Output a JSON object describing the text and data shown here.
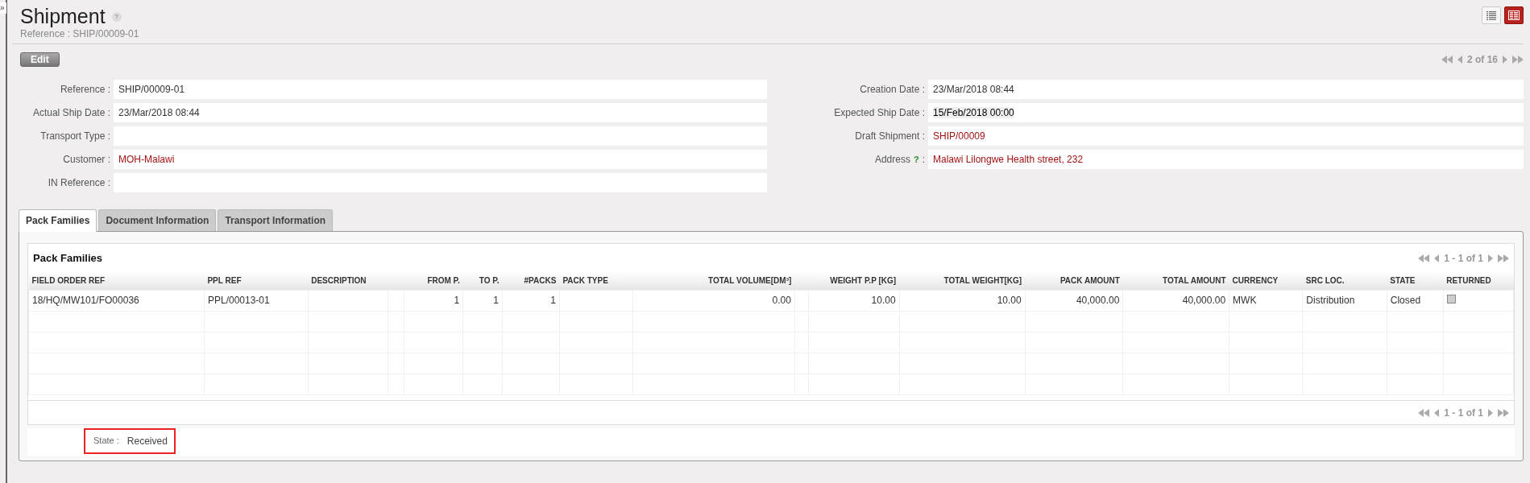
{
  "sidebar_toggle": "»",
  "header": {
    "title": "Shipment",
    "help": "?",
    "subtitle": "Reference : SHIP/00009-01"
  },
  "view_switch": [
    {
      "kind": "list",
      "selected": false
    },
    {
      "kind": "form",
      "selected": true
    }
  ],
  "toolbar": {
    "edit_button": "Edit",
    "pager": "2 of 16"
  },
  "form": {
    "left": [
      {
        "label": "Reference :",
        "value": "SHIP/00009-01",
        "kind": "plain"
      },
      {
        "label": "Actual Ship Date :",
        "value": "23/Mar/2018 08:44",
        "kind": "plain"
      },
      {
        "label": "Transport Type :"
      },
      {
        "label": "Customer :",
        "value": "MOH-Malawi",
        "kind": "link"
      },
      {
        "label": "IN Reference :"
      }
    ],
    "right": [
      {
        "label": "Creation Date :",
        "value": "23/Mar/2018 08:44",
        "kind": "plain"
      },
      {
        "label": "Expected Ship Date :",
        "value": "15/Feb/2018 00:00",
        "kind": "emphasis"
      },
      {
        "label": "Draft Shipment :",
        "value": "SHIP/00009",
        "kind": "link"
      },
      {
        "label": "Address",
        "help": "?",
        "separator": ":",
        "value": "Malawi Lilongwe Health street, 232",
        "kind": "link"
      }
    ]
  },
  "tabs": [
    {
      "label": "Pack Families",
      "selected": true
    },
    {
      "label": "Document Information",
      "selected": false
    },
    {
      "label": "Transport Information",
      "selected": false
    }
  ],
  "list": {
    "title": "Pack Families",
    "pager_top": "1 - 1 of 1",
    "pager_bottom": "1 - 1 of 1",
    "columns": [
      {
        "label": "FIELD ORDER REF",
        "kind": "text"
      },
      {
        "label": "PPL REF",
        "kind": "text"
      },
      {
        "label": "DESCRIPTION",
        "kind": "text"
      },
      {
        "label": "FROM P.",
        "kind": "number"
      },
      {
        "label": "TO P.",
        "kind": "number"
      },
      {
        "label": "#PACKS",
        "kind": "number"
      },
      {
        "label": "PACK TYPE",
        "kind": "text"
      },
      {
        "label": "TOTAL VOLUME[DM³]",
        "kind": "number"
      },
      {
        "label": "WEIGHT P.P [KG]",
        "kind": "number"
      },
      {
        "label": "TOTAL WEIGHT[KG]",
        "kind": "number"
      },
      {
        "label": "PACK AMOUNT",
        "kind": "number"
      },
      {
        "label": "TOTAL AMOUNT",
        "kind": "number"
      },
      {
        "label": "CURRENCY",
        "kind": "text"
      },
      {
        "label": "SRC LOC.",
        "kind": "text"
      },
      {
        "label": "STATE",
        "kind": "text"
      },
      {
        "label": "RETURNED",
        "kind": "text"
      }
    ],
    "rows": [
      {
        "cells": [
          "18/HQ/MW101/FO00036",
          "PPL/00013-01",
          "",
          "1",
          "1",
          "1",
          "",
          "0.00",
          "10.00",
          "10.00",
          "40,000.00",
          "40,000.00",
          "MWK",
          "Distribution",
          "Closed"
        ],
        "returned": false
      }
    ]
  },
  "footer": {
    "label": "State :",
    "value": "Received",
    "highlighted": true
  }
}
